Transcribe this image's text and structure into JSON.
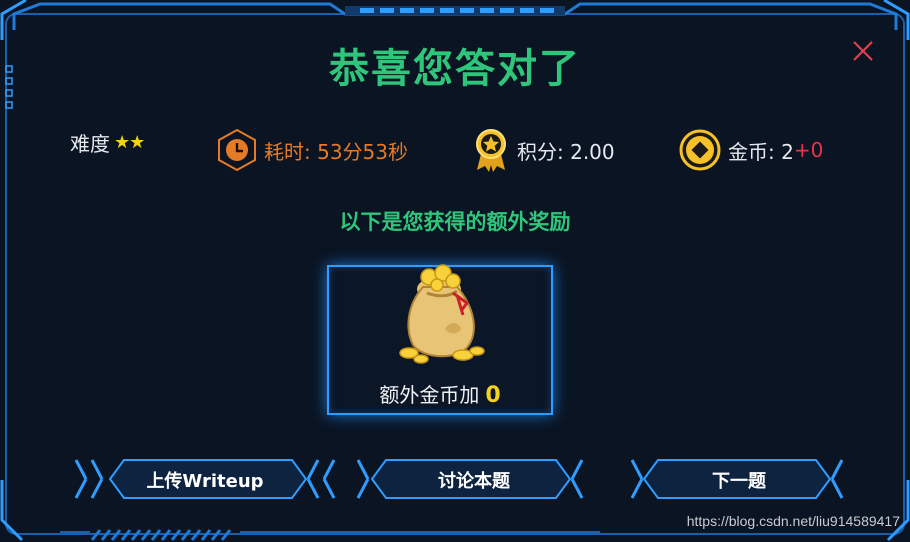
{
  "dialog": {
    "title": "恭喜您答对了",
    "close_icon": "close-icon"
  },
  "stats": {
    "difficulty_label": "难度",
    "difficulty_stars": "★★",
    "time_label": "耗时: 53分53秒",
    "score_label": "积分: 2.00",
    "coin_label": "金币: 2",
    "coin_bonus": "+0"
  },
  "reward": {
    "subtitle": "以下是您获得的额外奖励",
    "label": "额外金币加",
    "value": "0"
  },
  "buttons": {
    "upload": "上传Writeup",
    "discuss": "讨论本题",
    "next": "下一题"
  },
  "watermark": "https://blog.csdn.net/liu914589417",
  "colors": {
    "background": "#0a1422",
    "title_green": "#2fc67b",
    "time_orange": "#e57b26",
    "bonus_red": "#e4354a",
    "gold": "#f5d21b",
    "frame_blue": "#1f7bd8",
    "close_red": "#e0404f"
  }
}
